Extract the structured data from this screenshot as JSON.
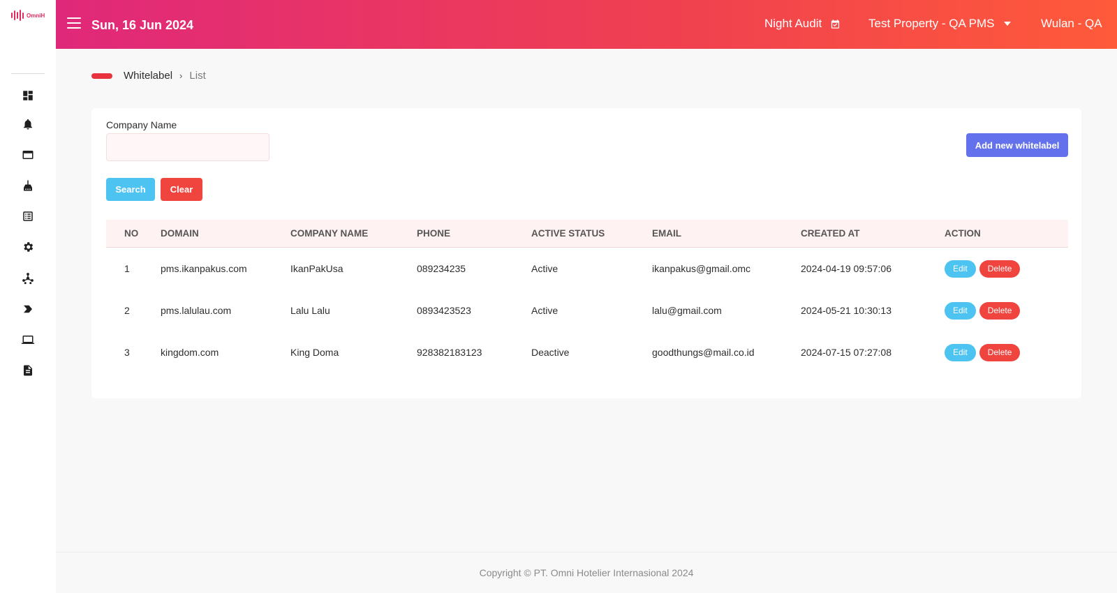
{
  "sidebar": {
    "logo_text": "OmniH",
    "icons": [
      "dashboard-icon",
      "notification-bell-icon",
      "window-icon",
      "housekeeping-icon",
      "list-icon",
      "settings-gear-icon",
      "network-icon",
      "tag-icon",
      "laptop-icon",
      "report-icon"
    ]
  },
  "header": {
    "date": "Sun, 16 Jun 2024",
    "night_audit": "Night Audit",
    "property": "Test Property - QA PMS",
    "user": "Wulan - QA"
  },
  "breadcrumb": {
    "parent": "Whitelabel",
    "current": "List"
  },
  "filter": {
    "company_name_label": "Company Name",
    "company_name_value": "",
    "company_name_placeholder": "",
    "search_label": "Search",
    "clear_label": "Clear",
    "add_label": "Add new whitelabel"
  },
  "table": {
    "headers": [
      "NO",
      "DOMAIN",
      "COMPANY NAME",
      "PHONE",
      "ACTIVE STATUS",
      "EMAIL",
      "CREATED AT",
      "ACTION"
    ],
    "rows": [
      {
        "no": "1",
        "domain": "pms.ikanpakus.com",
        "company": "IkanPakUsa",
        "phone": "089234235",
        "status": "Active",
        "email": "ikanpakus@gmail.omc",
        "created": "2024-04-19 09:57:06"
      },
      {
        "no": "2",
        "domain": "pms.lalulau.com",
        "company": "Lalu Lalu",
        "phone": "0893423523",
        "status": "Active",
        "email": "lalu@gmail.com",
        "created": "2024-05-21 10:30:13"
      },
      {
        "no": "3",
        "domain": "kingdom.com",
        "company": "King Doma",
        "phone": "928382183123",
        "status": "Deactive",
        "email": "goodthungs@mail.co.id",
        "created": "2024-07-15 07:27:08"
      }
    ],
    "edit_label": "Edit",
    "delete_label": "Delete"
  },
  "footer": {
    "copyright": "Copyright © PT. Omni Hotelier Internasional 2024"
  },
  "colors": {
    "header_gradient_start": "#e0287a",
    "header_gradient_end": "#ff5a3a",
    "search_button": "#4cc3f1",
    "clear_button": "#f0453f",
    "add_button": "#6371ec"
  }
}
